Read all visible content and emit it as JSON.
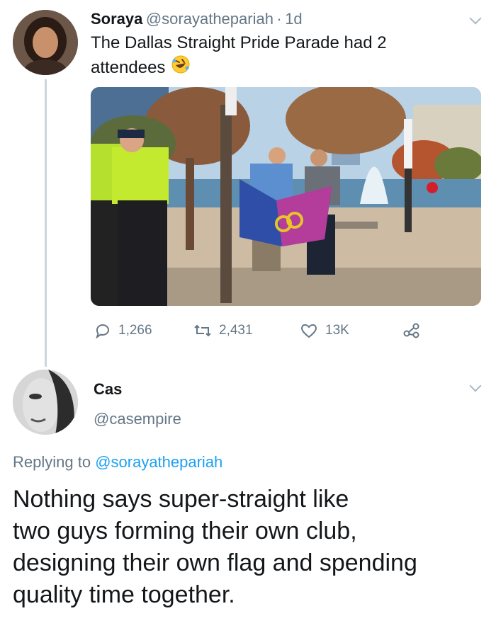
{
  "tweet": {
    "name": "Soraya",
    "handle": "@sorayathepariah",
    "separator": "·",
    "time": "1d",
    "text_line1": "The Dallas Straight Pride Parade had 2",
    "text_line2": "attendees",
    "emoji": "rolling-on-floor-laughing-emoji",
    "actions": {
      "replies": "1,266",
      "retweets": "2,431",
      "likes": "13K"
    }
  },
  "reply": {
    "name": "Cas",
    "handle": "@casempire",
    "replying_prefix": "Replying to ",
    "replying_handle": "@sorayathepariah",
    "text_lines": [
      "Nothing says super-straight like",
      "two guys forming their own club,",
      "designing their own flag and spending",
      "quality time together."
    ]
  },
  "colors": {
    "text": "#14171a",
    "secondary": "#657786",
    "link": "#1da1f2",
    "thread_line": "#ccd6dd"
  }
}
